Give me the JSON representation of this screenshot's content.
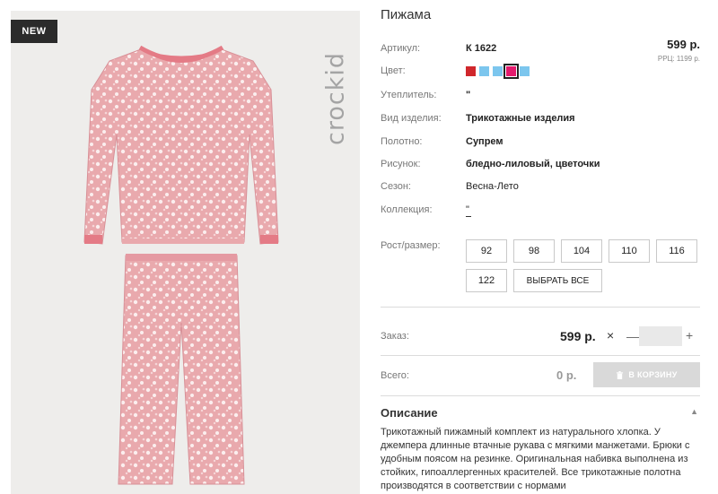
{
  "badge": "NEW",
  "brand": "crockid",
  "product": {
    "title": "Пижама",
    "price": "599 р.",
    "rrp": "РРЦ: 1199 р.",
    "attributes": [
      {
        "label": "Артикул:",
        "value": "К 1622"
      },
      {
        "label": "Утеплитель:",
        "value": "\""
      },
      {
        "label": "Вид изделия:",
        "value": "Трикотажные изделия"
      },
      {
        "label": "Полотно:",
        "value": "Супрем"
      },
      {
        "label": "Рисунок:",
        "value": "бледно-лиловый, цветочки"
      },
      {
        "label": "Сезон:",
        "value": "Весна-Лето"
      },
      {
        "label": "Коллекция:",
        "value": "\""
      }
    ],
    "color_label": "Цвет:",
    "colors": [
      {
        "hex": "#d0272c",
        "selected": false
      },
      {
        "hex": "#7cc6ee",
        "selected": false
      },
      {
        "hex": "#7cc6ee",
        "selected": false
      },
      {
        "hex": "#e31b6d",
        "selected": true
      },
      {
        "hex": "#7cc6ee",
        "selected": false
      }
    ],
    "size_label": "Рост/размер:",
    "sizes": [
      "92",
      "98",
      "104",
      "110",
      "116",
      "122"
    ],
    "select_all": "ВЫБРАТЬ ВСЕ"
  },
  "order": {
    "label": "Заказ:",
    "price": "599 р.",
    "times": "×",
    "minus": "—",
    "plus": "+",
    "qty": ""
  },
  "total": {
    "label": "Всего:",
    "value": "0 р.",
    "cart_button": "В КОРЗИНУ"
  },
  "description": {
    "title": "Описание",
    "caret": "▲",
    "text": "Трикотажный пижамный комплект из натурального хлопка. У джемпера длинные втачные рукава с мягкими манжетами. Брюки с удобным поясом на резинке. Оригинальная набивка выполнена из стойких, гипоаллергенных красителей. Все трикотажные полотна производятся в соответствии с нормами"
  },
  "colors": {
    "garment": "#e9a9ad",
    "trim": "#e47b86",
    "cart_button_bg": "#d9d9d9",
    "badge_bg": "#2b2b2b"
  },
  "icons": {
    "cart": "trash-basket-icon"
  }
}
